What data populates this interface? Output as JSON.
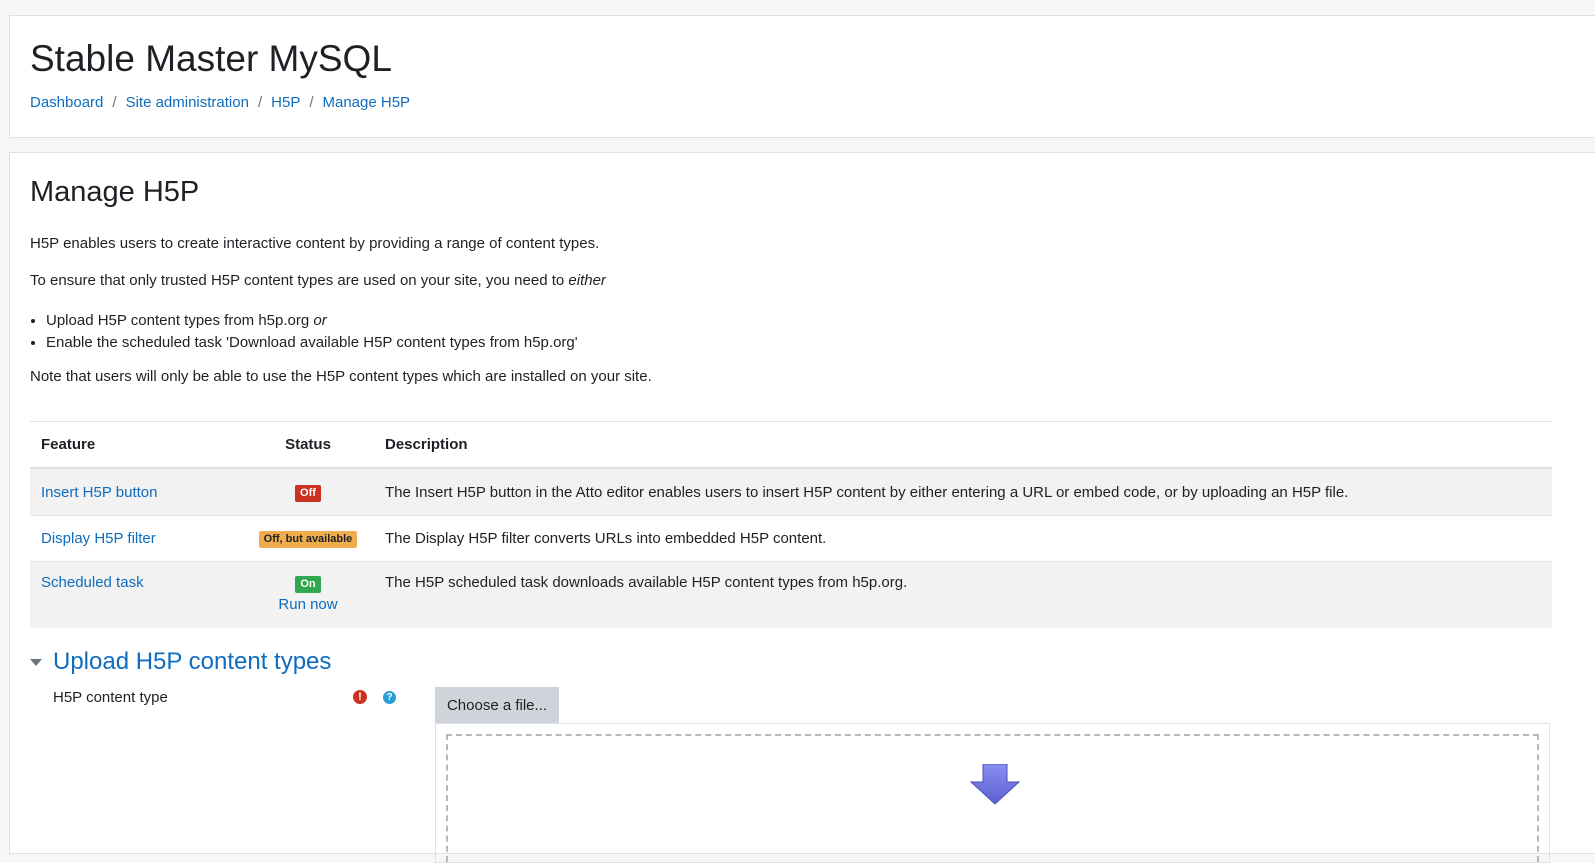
{
  "header": {
    "site_title": "Stable Master MySQL",
    "breadcrumb": [
      {
        "label": "Dashboard"
      },
      {
        "label": "Site administration"
      },
      {
        "label": "H5P"
      },
      {
        "label": "Manage H5P"
      }
    ],
    "separator": "/"
  },
  "main": {
    "heading": "Manage H5P",
    "intro": "H5P enables users to create interactive content by providing a range of content types.",
    "trusted_prefix": "To ensure that only trusted H5P content types are used on your site, you need to ",
    "trusted_emph": "either",
    "options": [
      {
        "text": "Upload H5P content types from h5p.org ",
        "emph": "or"
      },
      {
        "text": "Enable the scheduled task 'Download available H5P content types from h5p.org'",
        "emph": ""
      }
    ],
    "note": "Note that users will only be able to use the H5P content types which are installed on your site.",
    "table": {
      "headers": {
        "feature": "Feature",
        "status": "Status",
        "description": "Description"
      },
      "rows": [
        {
          "feature": "Insert H5P button",
          "status": "Off",
          "status_color": "#ca3120",
          "description": "The Insert H5P button in the Atto editor enables users to insert H5P content by either entering a URL or embed code, or by uploading an H5P file."
        },
        {
          "feature": "Display H5P filter",
          "status": "Off, but available",
          "status_color": "#f0ad4e",
          "description": "The Display H5P filter converts URLs into embedded H5P content."
        },
        {
          "feature": "Scheduled task",
          "status": "On",
          "status_color": "#2fa84f",
          "action": "Run now",
          "description": "The H5P scheduled task downloads available H5P content types from h5p.org."
        }
      ]
    },
    "upload_section": {
      "title": "Upload H5P content types",
      "field_label": "H5P content type",
      "required_icon": "exclamation-circle-icon",
      "help_icon": "question-circle-icon",
      "choose_button": "Choose a file...",
      "drop_icon": "download-arrow-icon"
    }
  },
  "colors": {
    "link": "#0f6cbf",
    "off": "#ca3120",
    "warning": "#f0ad4e",
    "on": "#2fa84f"
  }
}
